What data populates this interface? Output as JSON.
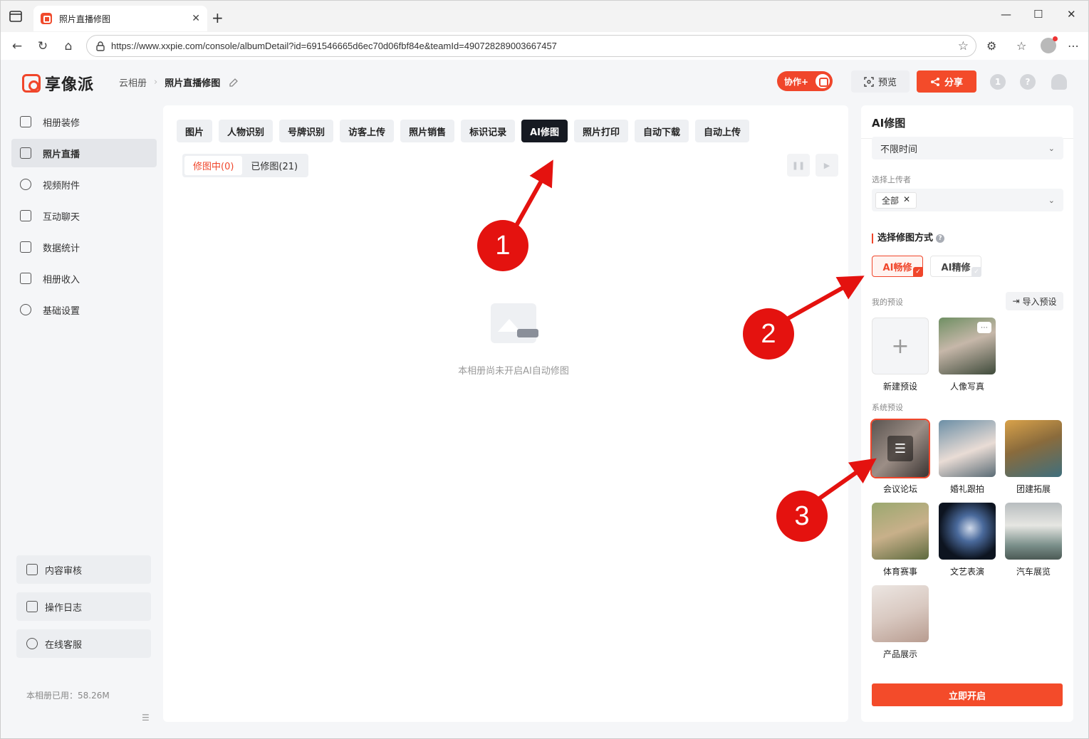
{
  "browser": {
    "tab_title": "照片直播修图",
    "url": "https://www.xxpie.com/console/albumDetail?id=691546665d6ec70d06fbf84e&teamId=490728289003667457"
  },
  "header": {
    "logo_text": "享像派",
    "breadcrumb_root": "云相册",
    "breadcrumb_current": "照片直播修图",
    "collab_label": "协作+",
    "preview_label": "预览",
    "share_label": "分享"
  },
  "sidebar": {
    "items": [
      {
        "label": "相册装修"
      },
      {
        "label": "照片直播"
      },
      {
        "label": "视频附件"
      },
      {
        "label": "互动聊天"
      },
      {
        "label": "数据统计"
      },
      {
        "label": "相册收入"
      },
      {
        "label": "基础设置"
      }
    ],
    "bottom": [
      {
        "label": "内容审核"
      },
      {
        "label": "操作日志"
      },
      {
        "label": "在线客服"
      }
    ],
    "usage": "本相册已用：58.26M"
  },
  "main": {
    "tabs": [
      "图片",
      "人物识别",
      "号牌识别",
      "访客上传",
      "照片销售",
      "标识记录",
      "AI修图",
      "照片打印",
      "自动下载",
      "自动上传"
    ],
    "active_tab": "AI修图",
    "subtabs": [
      "修图中(0)",
      "已修图(21)"
    ],
    "empty_text": "本相册尚未开启AI自动修图"
  },
  "panel": {
    "title": "AI修图",
    "time_select": "不限时间",
    "uploader_label": "选择上传者",
    "uploader_chip": "全部",
    "mode_section": "选择修图方式",
    "mode_fast": "AI畅修",
    "mode_fine": "AI精修",
    "my_presets_label": "我的预设",
    "import_label": "导入预设",
    "my_presets": [
      "新建预设",
      "人像写真"
    ],
    "system_presets_label": "系统预设",
    "system_presets": [
      "会议论坛",
      "婚礼跟拍",
      "团建拓展",
      "体育赛事",
      "文艺表演",
      "汽车展览",
      "产品展示"
    ],
    "start_label": "立即开启"
  },
  "annotations": [
    "1",
    "2",
    "3"
  ],
  "colors": {
    "accent": "#f34b2a",
    "annotation": "#e4120f",
    "active_tab_bg": "#161a22"
  }
}
